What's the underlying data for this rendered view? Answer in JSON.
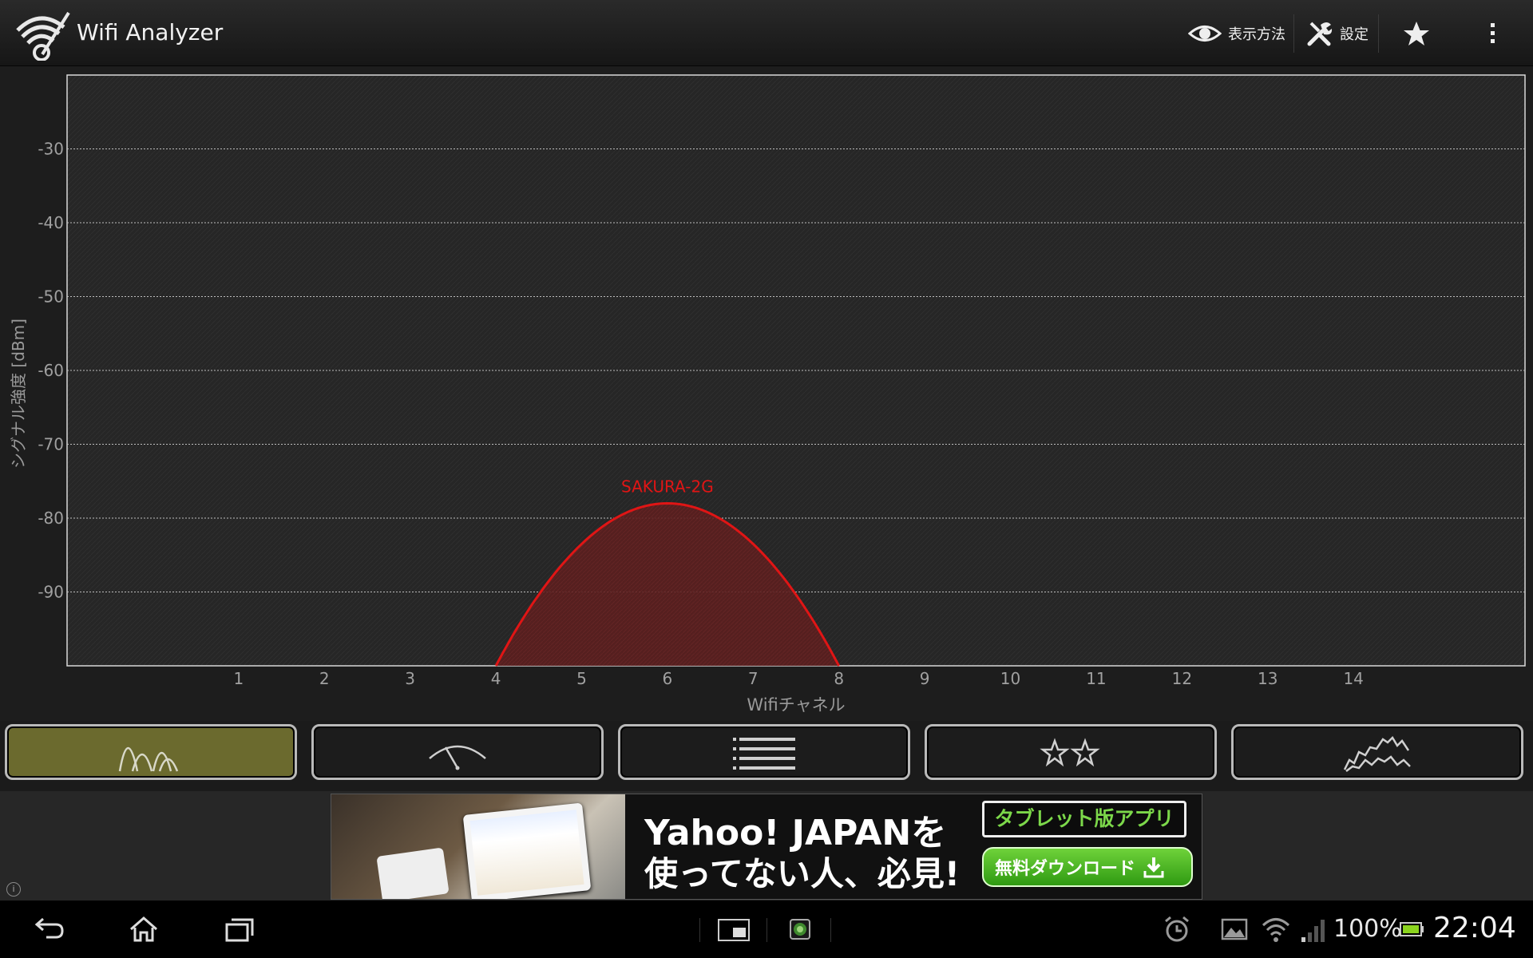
{
  "app": {
    "title": "Wifi Analyzer"
  },
  "action_bar": {
    "view_label": "表示方法",
    "settings_label": "設定",
    "icons": {
      "view": "eye-icon",
      "settings": "wrench-icon",
      "favorite": "star-icon",
      "overflow": "more-vert-icon"
    }
  },
  "chart_data": {
    "type": "area",
    "title": "",
    "xlabel": "Wifiチャネル",
    "ylabel": "シグナル強度 [dBm]",
    "y_ticks": [
      -30,
      -40,
      -50,
      -60,
      -70,
      -80,
      -90
    ],
    "x_ticks": [
      1,
      2,
      3,
      4,
      5,
      6,
      7,
      8,
      9,
      10,
      11,
      12,
      13,
      14
    ],
    "xlim": [
      -1,
      16
    ],
    "ylim": [
      -100,
      -20
    ],
    "grid": true,
    "series": [
      {
        "name": "SAKURA-2G",
        "channel": 6,
        "peak_dbm": -78,
        "span_channels": [
          4,
          8
        ],
        "color": "#e01515"
      }
    ]
  },
  "tabs": [
    {
      "name": "channel-graph",
      "icon": "channel-graph-icon",
      "active": true
    },
    {
      "name": "signal-meter",
      "icon": "meter-icon",
      "active": false
    },
    {
      "name": "ap-list",
      "icon": "list-icon",
      "active": false
    },
    {
      "name": "channel-rating",
      "icon": "stars-icon",
      "active": false
    },
    {
      "name": "time-graph",
      "icon": "time-graph-icon",
      "active": false
    }
  ],
  "ad": {
    "headline1": "Yahoo! JAPANを",
    "headline2": "使ってない人、必見!",
    "tag": "タブレット版アプリ",
    "cta": "無料ダウンロード"
  },
  "status": {
    "battery": "100%",
    "time": "22:04"
  }
}
